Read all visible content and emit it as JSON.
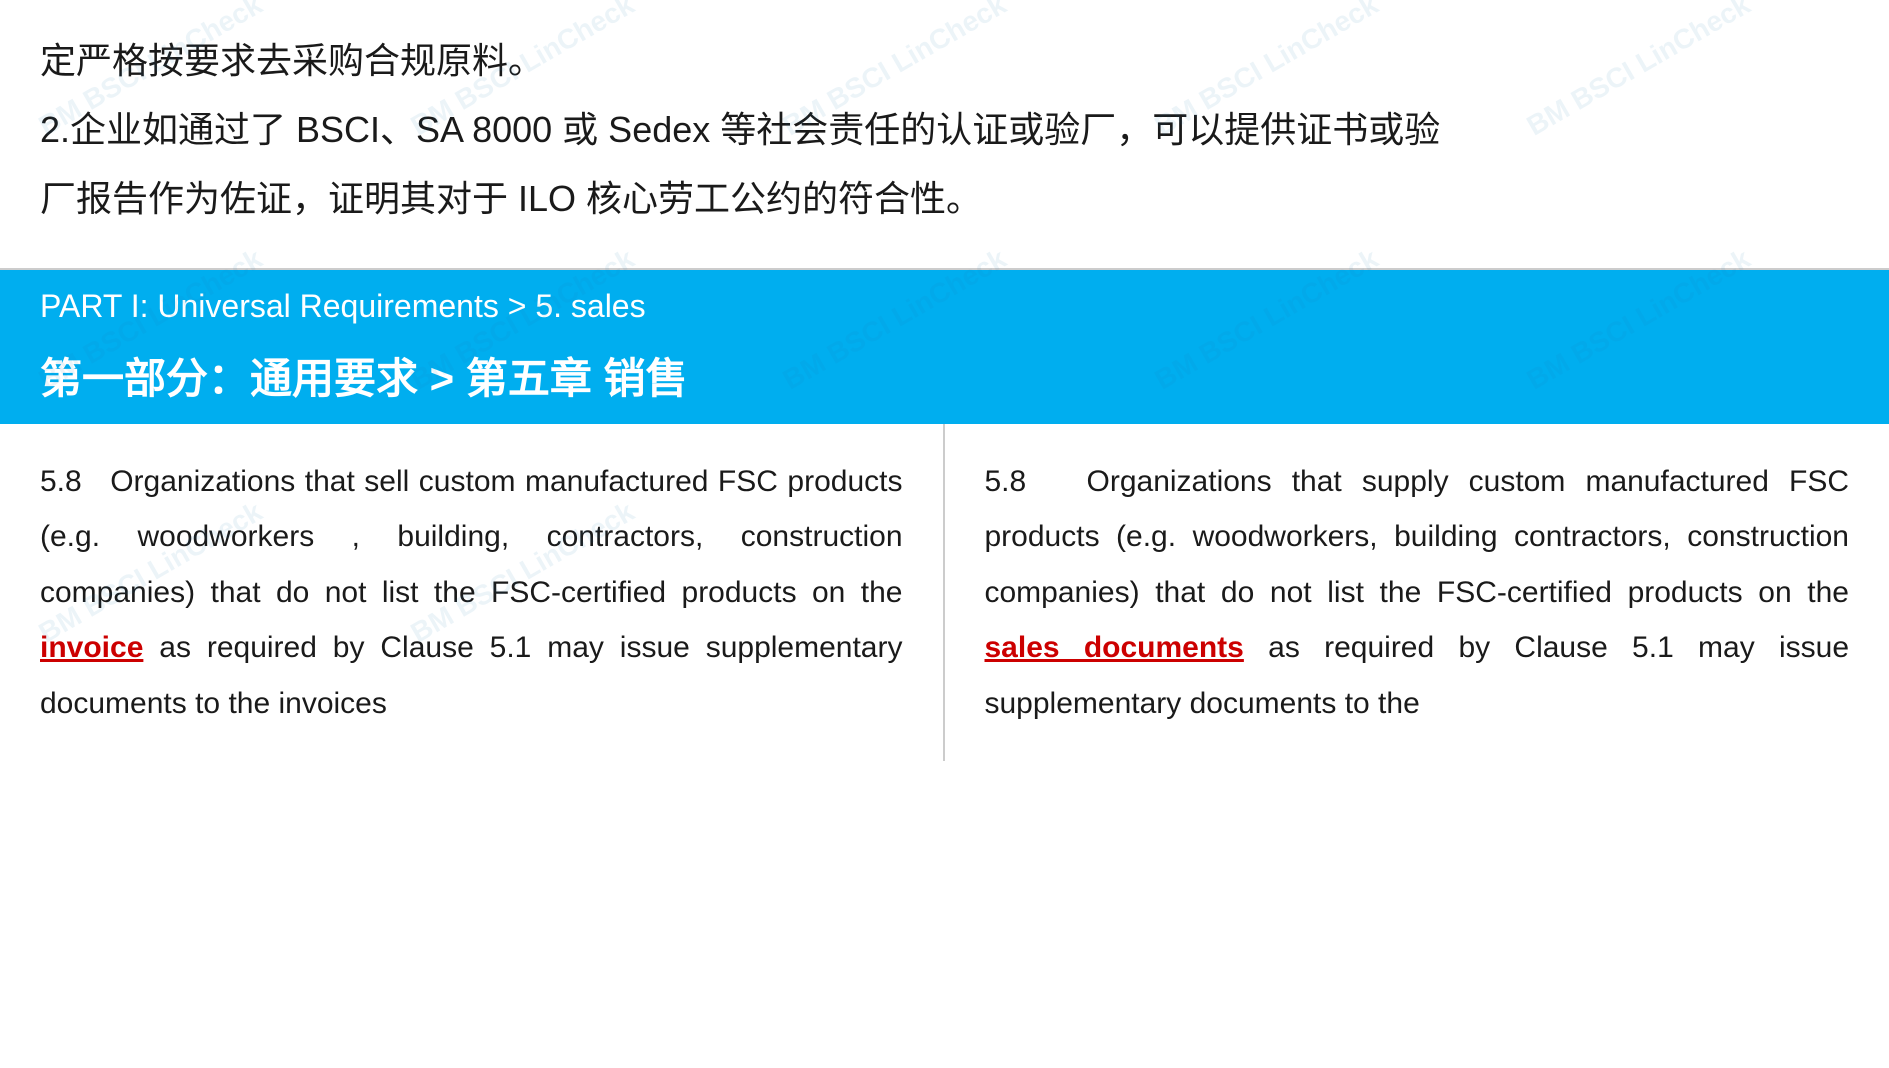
{
  "watermark": {
    "text": "BM BSCI LinCheck"
  },
  "top_section": {
    "line1": "定严格按要求去采购合规原料。",
    "line2": "2.企业如通过了 BSCI、SA 8000 或 Sedex 等社会责任的认证或验厂，可以提供证书或验",
    "line3": "厂报告作为佐证，证明其对于 ILO 核心劳工公约的符合性。"
  },
  "header": {
    "part_label": "PART I: Universal Requirements > 5. sales",
    "chinese_title": "第一部分：通用要求 > 第五章  销售"
  },
  "left_column": {
    "section_num": "5.8",
    "text_before_link": "Organizations that sell custom manufactured FSC products (e.g. woodworkers , building, contractors, construction companies) that do not list the FSC-certified products on the",
    "link_text": "invoice",
    "text_after_link": "as required by Clause 5.1 may issue supplementary documents to the invoices"
  },
  "right_column": {
    "section_num": "5.8",
    "text_before_link": "Organizations that supply custom manufactured FSC products (e.g. woodworkers, building contractors, construction companies) that do not list the FSC-certified products on the",
    "link_text": "sales documents",
    "text_after_link": "as required by Clause 5.1 may issue supplementary documents to the"
  },
  "colors": {
    "header_bg": "#00aeef",
    "header_text": "#ffffff",
    "link_color": "#cc0000",
    "body_text": "#1a1a1a",
    "border": "#cccccc"
  }
}
